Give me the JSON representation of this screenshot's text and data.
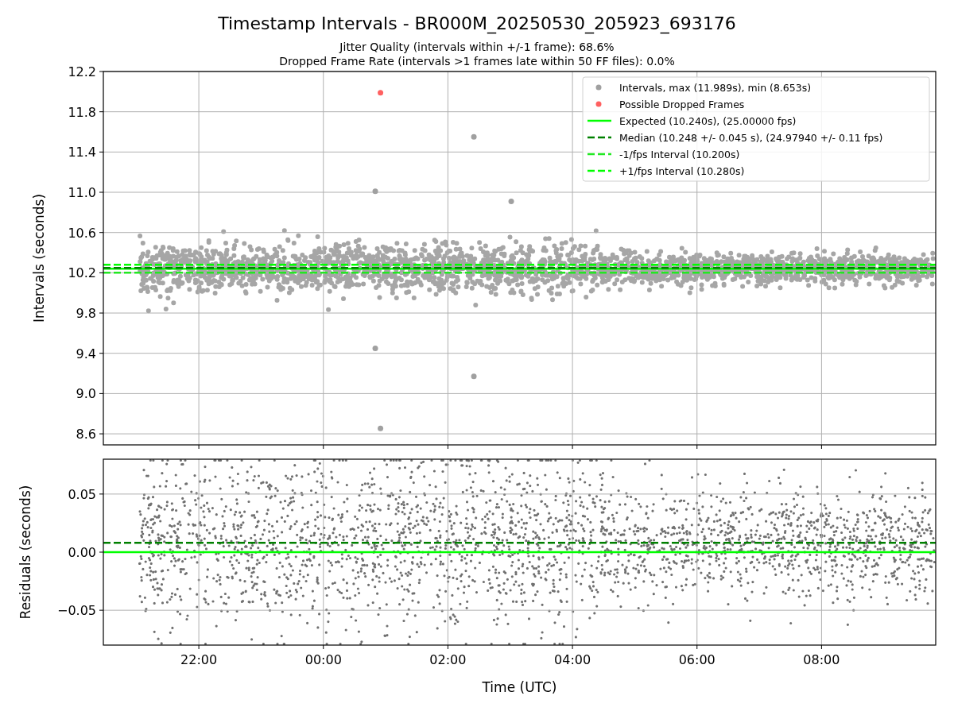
{
  "figure": {
    "title": "Timestamp Intervals - BR000M_20250530_205923_693176",
    "subtitles": [
      "Jitter Quality (intervals within +/-1 frame): 68.6%",
      "Dropped Frame Rate (intervals >1 frames late within 50 FF files): 0.0%"
    ]
  },
  "charts": [
    {
      "chart_data": {
        "type": "scatter",
        "grid": true,
        "legend": "upper right",
        "ylabel": "Intervals (seconds)",
        "xlim": [
          "2025-05-30T20:28",
          "2025-05-31T09:50"
        ],
        "ylim": [
          8.49,
          12.2
        ],
        "yticks": [
          {
            "value": 8.6,
            "label": "8.6"
          },
          {
            "value": 9.0,
            "label": "9.0"
          },
          {
            "value": 9.4,
            "label": "9.4"
          },
          {
            "value": 9.8,
            "label": "9.8"
          },
          {
            "value": 10.2,
            "label": "10.2"
          },
          {
            "value": 10.6,
            "label": "10.6"
          },
          {
            "value": 11.0,
            "label": "11.0"
          },
          {
            "value": 11.4,
            "label": "11.4"
          },
          {
            "value": 11.8,
            "label": "11.8"
          },
          {
            "value": 12.2,
            "label": "12.2"
          }
        ],
        "series": [
          {
            "name": "Intervals, max (11.989s), min (8.653s)",
            "type": "scatter",
            "color": "#a0a0a0",
            "x": [
              "2025-05-31T00:50",
              "2025-05-31T00:50",
              "2025-05-31T00:55",
              "2025-05-31T02:25",
              "2025-05-31T02:25",
              "2025-05-31T03:01"
            ],
            "values": [
              11.01,
              9.45,
              8.653,
              11.55,
              9.17,
              10.91
            ]
          },
          {
            "name": "Possible Dropped Frames",
            "type": "scatter",
            "color": "#ff6060",
            "x": [
              "2025-05-31T00:55"
            ],
            "values": [
              11.989
            ]
          },
          {
            "name": "Expected (10.240s), (25.00000 fps)",
            "type": "line",
            "color": "#00ff00",
            "x": [
              "2025-05-30T20:28",
              "2025-05-31T09:50"
            ],
            "values": [
              10.24,
              10.24
            ]
          },
          {
            "name": "Median (10.248 +/- 0.045 s), (24.97940 +/- 0.11 fps)",
            "type": "line",
            "line_style": "dashed",
            "color": "#008000",
            "x": [
              "2025-05-30T20:28",
              "2025-05-31T09:50"
            ],
            "values": [
              10.248,
              10.248
            ]
          },
          {
            "name": "-1/fps Interval (10.200s)",
            "type": "line",
            "line_style": "dashed",
            "color": "#22e822",
            "x": [
              "2025-05-30T20:28",
              "2025-05-31T09:50"
            ],
            "values": [
              10.2,
              10.2
            ]
          },
          {
            "name": "+1/fps Interval (10.280s)",
            "type": "line",
            "line_style": "dashed",
            "color": "#00ff00",
            "x": [
              "2025-05-30T20:28",
              "2025-05-31T09:50"
            ],
            "values": [
              10.28,
              10.28
            ]
          }
        ]
      }
    },
    {
      "chart_data": {
        "type": "scatter",
        "grid": true,
        "xlabel": "Time (UTC)",
        "ylabel": "Residuals (seconds)",
        "xlim": [
          "2025-05-30T20:28",
          "2025-05-31T09:50"
        ],
        "ylim": [
          -0.08,
          0.08
        ],
        "xticks": [
          {
            "value": "2025-05-30T22:00",
            "label": "22:00"
          },
          {
            "value": "2025-05-31T00:00",
            "label": "00:00"
          },
          {
            "value": "2025-05-31T02:00",
            "label": "02:00"
          },
          {
            "value": "2025-05-31T04:00",
            "label": "04:00"
          },
          {
            "value": "2025-05-31T06:00",
            "label": "06:00"
          },
          {
            "value": "2025-05-31T08:00",
            "label": "08:00"
          }
        ],
        "yticks": [
          {
            "value": -0.05,
            "label": "−0.05"
          },
          {
            "value": 0,
            "label": "0.00"
          },
          {
            "value": 0.05,
            "label": "0.05"
          }
        ],
        "series": [
          {
            "type": "line",
            "color": "#00ff00",
            "x": [
              "2025-05-30T20:28",
              "2025-05-31T09:50"
            ],
            "values": [
              0,
              0
            ]
          },
          {
            "type": "line",
            "line_style": "dashed",
            "color": "#008000",
            "x": [
              "2025-05-30T20:28",
              "2025-05-31T09:50"
            ],
            "values": [
              0.008,
              0.008
            ]
          }
        ]
      }
    }
  ]
}
